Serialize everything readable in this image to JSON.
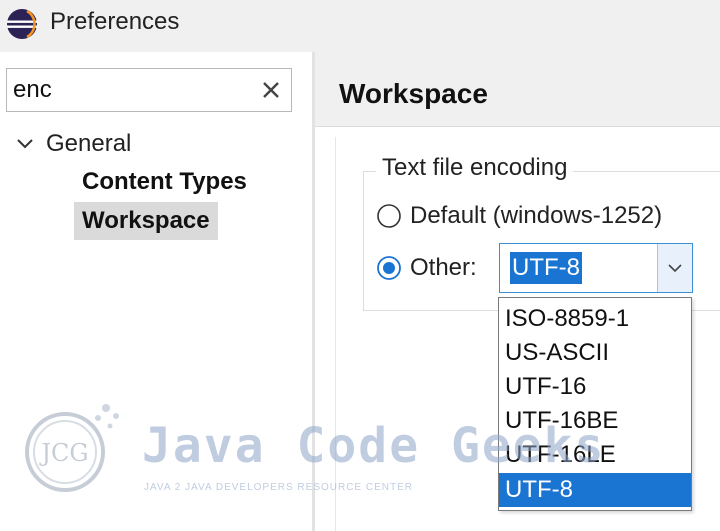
{
  "window": {
    "title": "Preferences",
    "icon": "eclipse-icon"
  },
  "filter": {
    "value": "enc",
    "clear_icon": "close-icon"
  },
  "tree": {
    "general": "General",
    "children": [
      "Content Types",
      "Workspace"
    ],
    "selected": "Workspace"
  },
  "page": {
    "title": "Workspace"
  },
  "encoding": {
    "group_label": "Text file encoding",
    "default_label": "Default (windows-1252)",
    "other_label": "Other:",
    "selected_option": "Other",
    "combo_value": "UTF-8",
    "options": [
      "ISO-8859-1",
      "US-ASCII",
      "UTF-16",
      "UTF-16BE",
      "UTF-16LE",
      "UTF-8"
    ],
    "highlighted_option": "UTF-8"
  },
  "watermark": {
    "logo_text": "JCG",
    "name": "Java Code Geeks",
    "tagline": "JAVA 2 JAVA DEVELOPERS RESOURCE CENTER"
  },
  "colors": {
    "selection": "#1a74d1",
    "tree_selection": "#dadada",
    "accent": "#3b8fd6"
  }
}
